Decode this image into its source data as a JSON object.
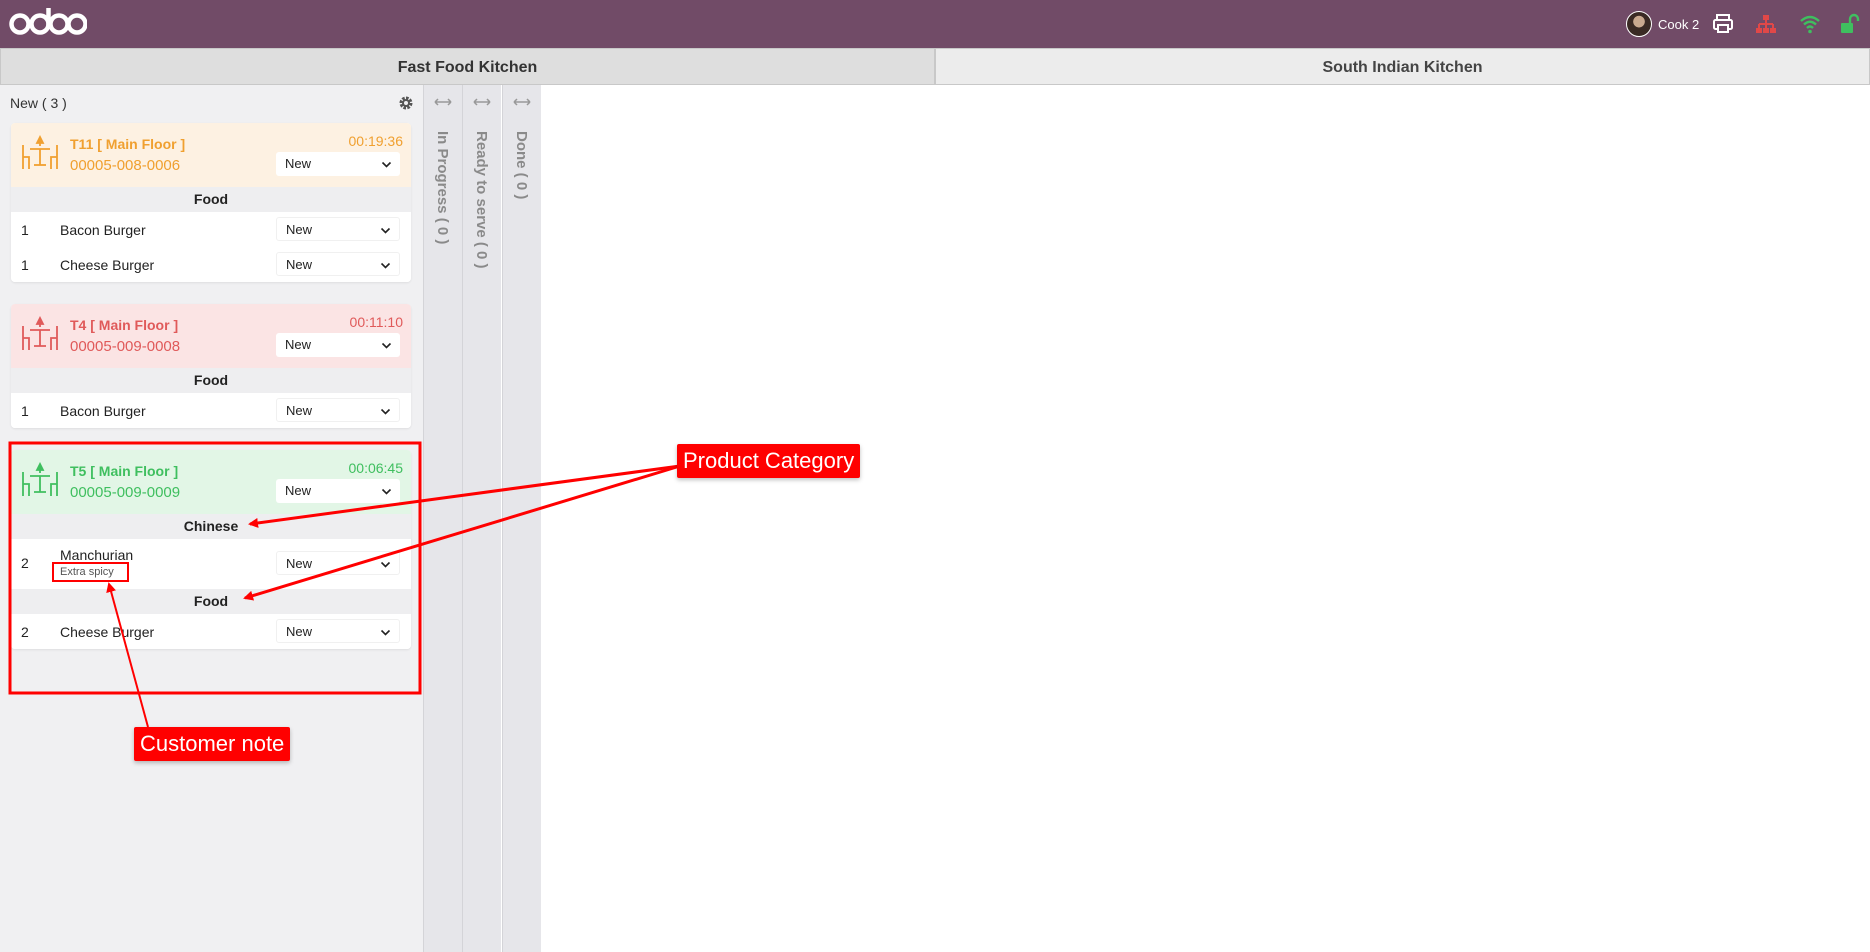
{
  "topbar": {
    "logo": "odoo",
    "user": {
      "name": "Cook 2"
    },
    "icons": [
      "printer-icon",
      "sitemap-icon",
      "wifi-icon",
      "unlock-icon"
    ],
    "colors": {
      "bar": "#714b67",
      "wifi": "#3fbf5f",
      "unlock": "#3fbf5f",
      "sitemap": "#e04848"
    }
  },
  "kitchens": [
    {
      "label": "Fast Food Kitchen",
      "active": true
    },
    {
      "label": "South Indian Kitchen",
      "active": false
    }
  ],
  "stages": {
    "new": {
      "label": "New ( 3 )"
    },
    "in_progress": {
      "label": "In Progress ( 0 )"
    },
    "ready": {
      "label": "Ready to serve ( 0 )"
    },
    "done": {
      "label": "Done ( 0 )"
    }
  },
  "orders": [
    {
      "table": "T11 [ Main Floor ]",
      "ref": "00005-008-0006",
      "timer": "00:19:36",
      "status": "New",
      "groups": [
        {
          "category": "Food",
          "lines": [
            {
              "qty": "1",
              "product": "Bacon Burger",
              "status": "New"
            },
            {
              "qty": "1",
              "product": "Cheese Burger",
              "status": "New"
            }
          ]
        }
      ]
    },
    {
      "table": "T4 [ Main Floor ]",
      "ref": "00005-009-0008",
      "timer": "00:11:10",
      "status": "New",
      "groups": [
        {
          "category": "Food",
          "lines": [
            {
              "qty": "1",
              "product": "Bacon Burger",
              "status": "New"
            }
          ]
        }
      ]
    },
    {
      "table": "T5 [ Main Floor ]",
      "ref": "00005-009-0009",
      "timer": "00:06:45",
      "status": "New",
      "groups": [
        {
          "category": "Chinese",
          "lines": [
            {
              "qty": "2",
              "product": "Manchurian",
              "note": "Extra spicy",
              "status": "New"
            }
          ]
        },
        {
          "category": "Food",
          "lines": [
            {
              "qty": "2",
              "product": "Cheese Burger",
              "status": "New"
            }
          ]
        }
      ]
    }
  ],
  "annotations": {
    "product_category": "Product Category",
    "customer_note": "Customer note",
    "color": "#ff0000"
  }
}
